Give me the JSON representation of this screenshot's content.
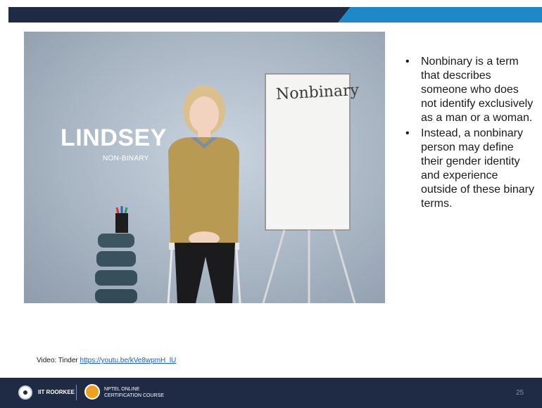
{
  "slide": {
    "page_number": "25",
    "caption_prefix": "Video: Tinder",
    "caption_link": "https://youtu.be/kVe8wpmH_lU"
  },
  "video": {
    "name": "LINDSEY",
    "subtitle": "NON-BINARY",
    "board_word": "Nonbinary"
  },
  "bullets": [
    "Nonbinary is a term that describes someone who does not identify exclusively as a man or a woman.",
    "Instead, a nonbinary person may define their gender identity and experience outside of these binary terms."
  ],
  "footer": {
    "institute": "IIT ROORKEE",
    "nptel_line1": "NPTEL ONLINE",
    "nptel_line2": "CERTIFICATION COURSE"
  },
  "colors": {
    "header": "#1f2a44",
    "accent": "#1e88c8",
    "footer": "#1f2a44"
  }
}
